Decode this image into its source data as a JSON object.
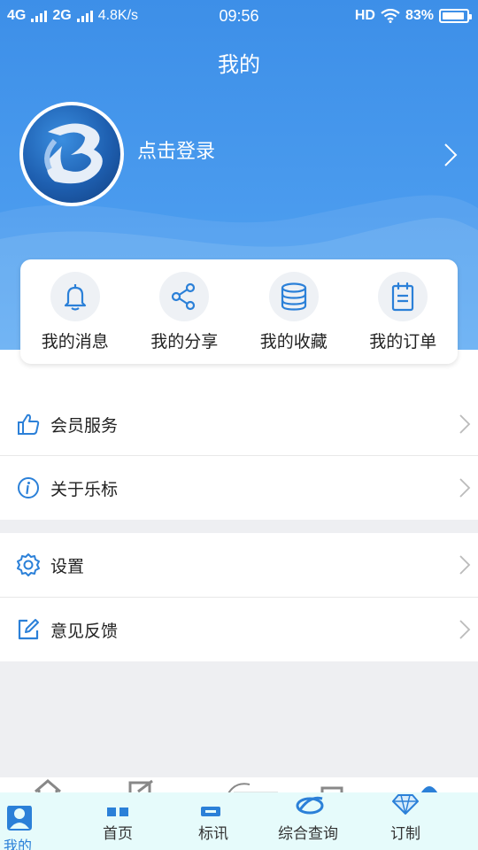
{
  "status_bar": {
    "network1": "4G",
    "network2": "2G",
    "speed": "4.8K/s",
    "time": "09:56",
    "hd": "HD",
    "battery": "83%"
  },
  "header": {
    "title": "我的",
    "login_text": "点击登录"
  },
  "quick_actions": [
    {
      "label": "我的消息",
      "icon": "bell-icon"
    },
    {
      "label": "我的分享",
      "icon": "share-icon"
    },
    {
      "label": "我的收藏",
      "icon": "database-icon"
    },
    {
      "label": "我的订单",
      "icon": "clipboard-icon"
    }
  ],
  "menu": {
    "group1": [
      {
        "label": "会员服务",
        "icon": "thumbs-up-icon"
      },
      {
        "label": "关于乐标",
        "icon": "info-icon"
      }
    ],
    "group2": [
      {
        "label": "设置",
        "icon": "gear-icon"
      },
      {
        "label": "意见反馈",
        "icon": "edit-icon"
      }
    ]
  },
  "tabbar": {
    "active": "我的",
    "items": [
      {
        "label": "首页",
        "icon": "home-icon"
      },
      {
        "label": "标讯",
        "icon": "news-icon"
      },
      {
        "label": "综合查询",
        "icon": "search-globe-icon"
      },
      {
        "label": "订制",
        "icon": "diamond-icon"
      }
    ]
  },
  "colors": {
    "accent": "#2b80d8",
    "header_blue": "#4a9bee"
  }
}
